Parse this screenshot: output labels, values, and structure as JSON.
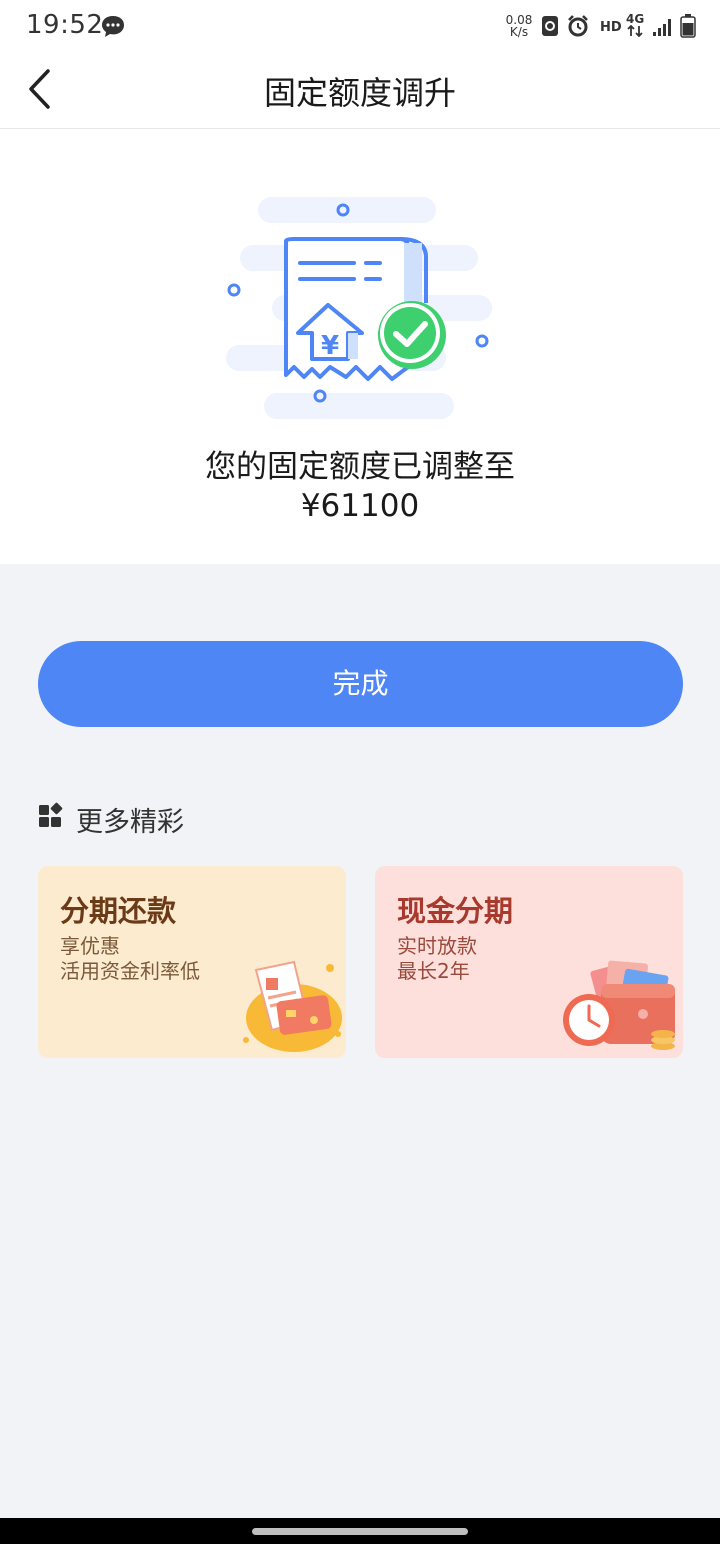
{
  "status_bar": {
    "time": "19:52",
    "net_speed_value": "0.08",
    "net_speed_unit": "K/s",
    "hd": "HD",
    "network": "4G"
  },
  "nav": {
    "title": "固定额度调升"
  },
  "result": {
    "message": "您的固定额度已调整至",
    "amount": "¥61100"
  },
  "actions": {
    "done_label": "完成"
  },
  "more": {
    "title": "更多精彩",
    "cards": [
      {
        "title": "分期还款",
        "line1": "享优惠",
        "line2": "活用资金利率低"
      },
      {
        "title": "现金分期",
        "line1": "实时放款",
        "line2": "最长2年"
      }
    ]
  },
  "colors": {
    "accent": "#4e86f6",
    "success": "#3ecf6e",
    "page_bg": "#f1f3f7"
  }
}
